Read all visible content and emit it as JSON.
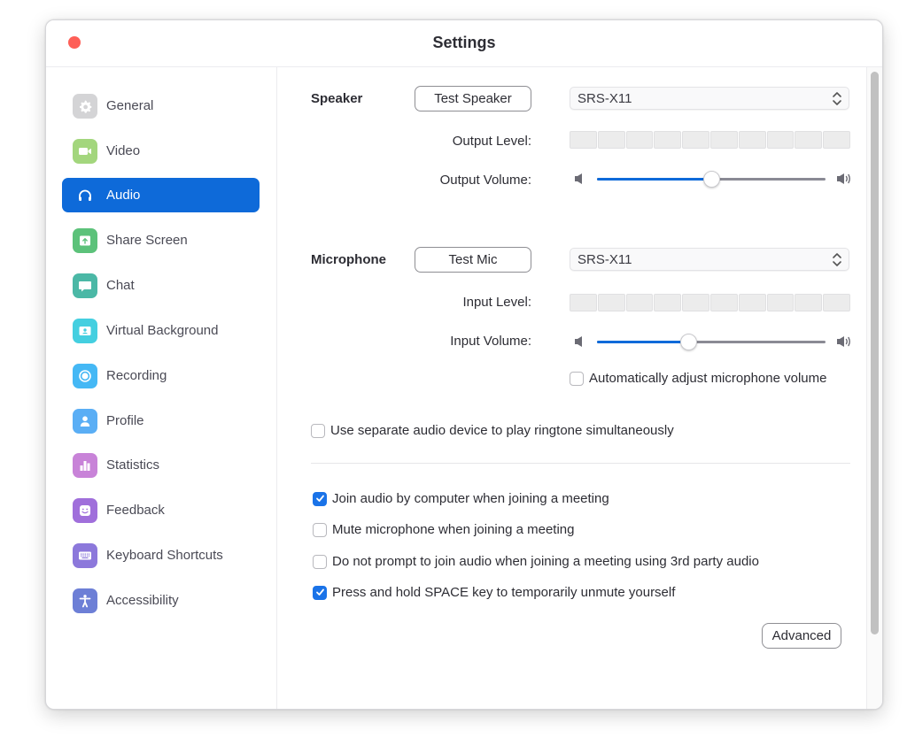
{
  "window": {
    "title": "Settings"
  },
  "sidebar": {
    "active": "Audio",
    "items": [
      {
        "label": "General",
        "icon": "gear-icon",
        "color": "#d4d4d6"
      },
      {
        "label": "Video",
        "icon": "video-camera-icon",
        "color": "#a3d67d"
      },
      {
        "label": "Audio",
        "icon": "headphones-icon",
        "color": "#0e6ad9"
      },
      {
        "label": "Share Screen",
        "icon": "share-screen-icon",
        "color": "#5cc27a"
      },
      {
        "label": "Chat",
        "icon": "chat-bubble-icon",
        "color": "#4bb8a6"
      },
      {
        "label": "Virtual Background",
        "icon": "virtual-background-icon",
        "color": "#44cfe0"
      },
      {
        "label": "Recording",
        "icon": "record-icon",
        "color": "#45b8f5"
      },
      {
        "label": "Profile",
        "icon": "person-icon",
        "color": "#5aaef5"
      },
      {
        "label": "Statistics",
        "icon": "bar-chart-icon",
        "color": "#c883d8"
      },
      {
        "label": "Feedback",
        "icon": "smiley-icon",
        "color": "#a06fdb"
      },
      {
        "label": "Keyboard Shortcuts",
        "icon": "keyboard-icon",
        "color": "#8c78db"
      },
      {
        "label": "Accessibility",
        "icon": "accessibility-icon",
        "color": "#6d7fd6"
      }
    ]
  },
  "speaker": {
    "label": "Speaker",
    "test_button": "Test Speaker",
    "device": "SRS-X11",
    "level_label": "Output Level:",
    "level_segments": 10,
    "level_active": 0,
    "volume_label": "Output Volume:",
    "volume": 0.5
  },
  "microphone": {
    "label": "Microphone",
    "test_button": "Test Mic",
    "device": "SRS-X11",
    "level_label": "Input Level:",
    "level_segments": 10,
    "level_active": 0,
    "volume_label": "Input Volume:",
    "volume": 0.4,
    "auto_adjust": {
      "label": "Automatically adjust microphone volume",
      "checked": false
    }
  },
  "ringtone": {
    "label": "Use separate audio device to play ringtone simultaneously",
    "checked": false
  },
  "options": [
    {
      "label": "Join audio by computer when joining a meeting",
      "checked": true
    },
    {
      "label": "Mute microphone when joining a meeting",
      "checked": false
    },
    {
      "label": "Do not prompt to join audio when joining a meeting using 3rd party audio",
      "checked": false
    },
    {
      "label": "Press and hold SPACE key to temporarily unmute yourself",
      "checked": true
    }
  ],
  "advanced_button": "Advanced",
  "colors": {
    "accent": "#0e6ad9",
    "checkbox_checked": "#1a73e8",
    "close": "#fe5f57"
  }
}
